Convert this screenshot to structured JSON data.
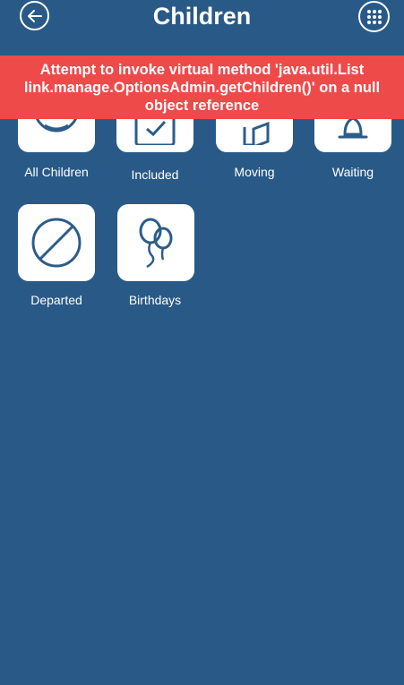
{
  "header": {
    "title": "Children",
    "back_icon": "arrow-left-circle-icon",
    "menu_icon": "grid-dots-icon"
  },
  "error": {
    "message": "Attempt to invoke virtual method 'java.util.List link.manage.OptionsAdmin.getChildren()' on a null object reference",
    "color": "#ef4a4a"
  },
  "tiles": [
    {
      "label": "All Children",
      "icon": "child-face-icon"
    },
    {
      "label": "Included",
      "icon": "calendar-check-icon"
    },
    {
      "label": "Moving",
      "icon": "door-exit-icon"
    },
    {
      "label": "Waiting",
      "icon": "bell-icon"
    },
    {
      "label": "Departed",
      "icon": "prohibited-icon"
    },
    {
      "label": "Birthdays",
      "icon": "balloons-icon"
    }
  ],
  "colors": {
    "background": "#295a87",
    "tile": "#ffffff",
    "icon": "#2b5d8a"
  }
}
